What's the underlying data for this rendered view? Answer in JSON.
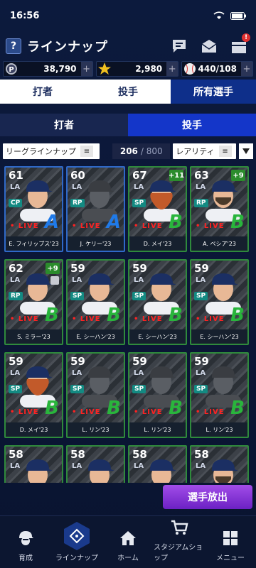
{
  "status": {
    "time": "16:56"
  },
  "header": {
    "help": "?",
    "title": "ラインナップ",
    "badge": "!"
  },
  "currency": [
    {
      "icon": "p-coin-icon",
      "value": "38,790"
    },
    {
      "icon": "star-icon",
      "value": "2,980"
    },
    {
      "icon": "baseball-icon",
      "value": "440/108"
    }
  ],
  "tabs1": [
    {
      "label": "打者",
      "active": false
    },
    {
      "label": "投手",
      "active": false
    },
    {
      "label": "所有選手",
      "active": true
    }
  ],
  "tabs2": [
    {
      "label": "打者",
      "active": false
    },
    {
      "label": "投手",
      "active": true
    }
  ],
  "filters": {
    "league": "リーグラインナップ",
    "count": "206",
    "total": "/ 800",
    "sort": "レアリティ"
  },
  "cards": [
    {
      "num": "61",
      "pos": "CP",
      "plus": "",
      "grade": "A",
      "live": "• LIVE",
      "name": "E. フィリップス'23",
      "style": "blue",
      "face": "photo"
    },
    {
      "num": "60",
      "pos": "RP",
      "plus": "",
      "grade": "A",
      "live": "• LIVE",
      "name": "J. ケリー'23",
      "style": "blue",
      "face": "silhouette"
    },
    {
      "num": "67",
      "pos": "SP",
      "plus": "+11",
      "grade": "B",
      "live": "• LIVE",
      "name": "D. メイ'23",
      "style": "green",
      "face": "redbeard"
    },
    {
      "num": "63",
      "pos": "RP",
      "plus": "+9",
      "grade": "B",
      "live": "• LIVE",
      "name": "A. ベシア'23",
      "style": "green",
      "face": "beard"
    },
    {
      "num": "62",
      "pos": "RP",
      "plus": "+9",
      "grade": "B",
      "live": "• LIVE",
      "name": "S. ミラー'23",
      "style": "green",
      "face": "photo",
      "lock": true
    },
    {
      "num": "59",
      "pos": "SP",
      "plus": "",
      "grade": "B",
      "live": "• LIVE",
      "name": "E. シーハン'23",
      "style": "green",
      "face": "photo"
    },
    {
      "num": "59",
      "pos": "SP",
      "plus": "",
      "grade": "B",
      "live": "• LIVE",
      "name": "E. シーハン'23",
      "style": "green",
      "face": "photo"
    },
    {
      "num": "59",
      "pos": "SP",
      "plus": "",
      "grade": "B",
      "live": "• LIVE",
      "name": "E. シーハン'23",
      "style": "green",
      "face": "photo"
    },
    {
      "num": "59",
      "pos": "SP",
      "plus": "",
      "grade": "B",
      "live": "• LIVE",
      "name": "D. メイ'23",
      "style": "green",
      "face": "redbeard"
    },
    {
      "num": "59",
      "pos": "SP",
      "plus": "",
      "grade": "B",
      "live": "• LIVE",
      "name": "L. リン'23",
      "style": "green",
      "face": "silhouette"
    },
    {
      "num": "59",
      "pos": "SP",
      "plus": "",
      "grade": "B",
      "live": "• LIVE",
      "name": "L. リン'23",
      "style": "green",
      "face": "silhouette"
    },
    {
      "num": "59",
      "pos": "SP",
      "plus": "",
      "grade": "B",
      "live": "• LIVE",
      "name": "L. リン'23",
      "style": "green",
      "face": "silhouette"
    },
    {
      "num": "58",
      "pos": "",
      "plus": "",
      "grade": "",
      "live": "",
      "name": "",
      "style": "green",
      "face": "photo"
    },
    {
      "num": "58",
      "pos": "",
      "plus": "",
      "grade": "",
      "live": "",
      "name": "",
      "style": "green",
      "face": "photo"
    },
    {
      "num": "58",
      "pos": "",
      "plus": "",
      "grade": "",
      "live": "",
      "name": "",
      "style": "green",
      "face": "photo"
    },
    {
      "num": "58",
      "pos": "",
      "plus": "",
      "grade": "",
      "live": "",
      "name": "",
      "style": "green",
      "face": "beard"
    }
  ],
  "card_logo": "LA",
  "release_button": "選手放出",
  "nav": [
    {
      "label": "育成",
      "icon": "player-icon",
      "active": false
    },
    {
      "label": "ラインナップ",
      "icon": "diamond-field-icon",
      "active": true
    },
    {
      "label": "ホーム",
      "icon": "home-icon",
      "active": false
    },
    {
      "label": "スタジアムショップ",
      "icon": "cart-icon",
      "active": false
    },
    {
      "label": "メニュー",
      "icon": "menu-grid-icon",
      "active": false
    }
  ],
  "colors": {
    "accent": "#1436c9",
    "live": "#ff2222",
    "gradeA": "#1f7ae8",
    "gradeB": "#29b53c",
    "release": "#8a38d8"
  }
}
